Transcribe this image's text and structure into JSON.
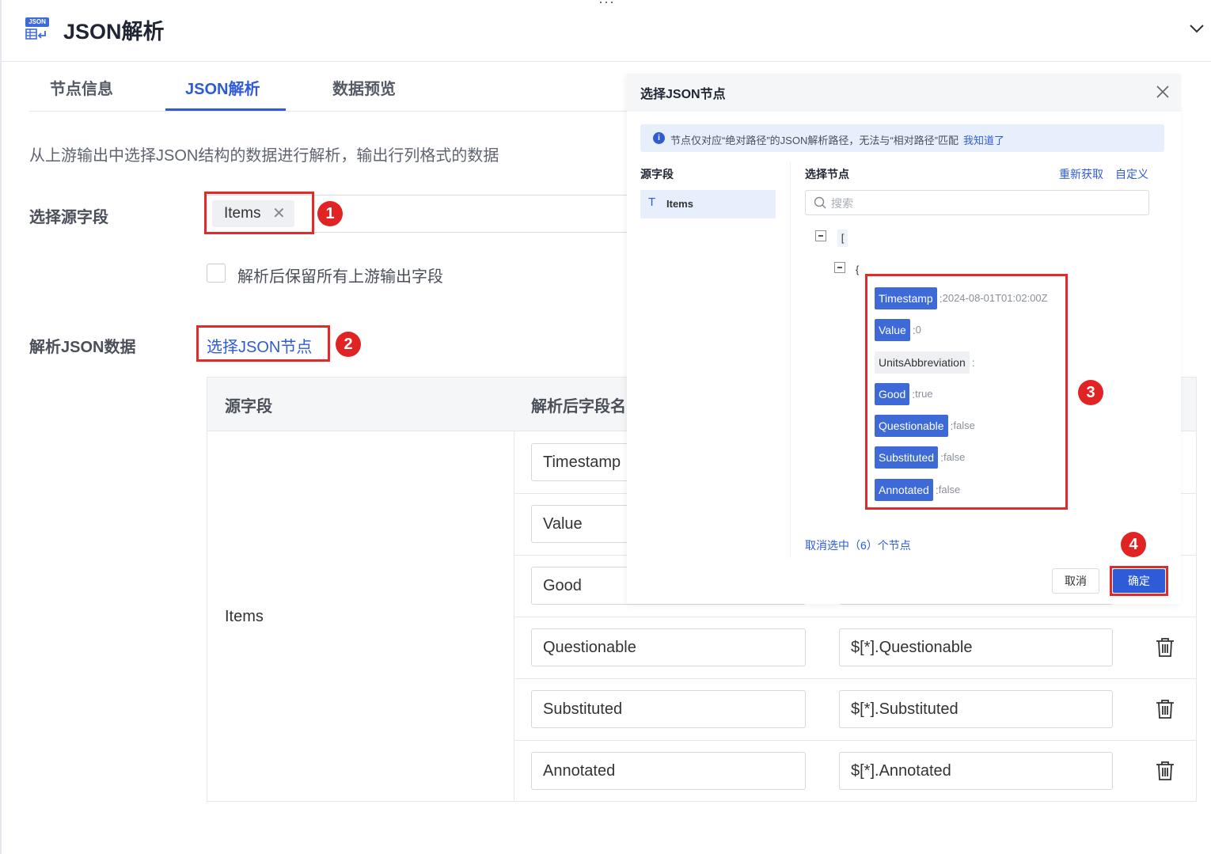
{
  "header": {
    "icon_tag": "JSON",
    "title": "JSON解析"
  },
  "tabs": [
    {
      "label": "节点信息",
      "active": false
    },
    {
      "label": "JSON解析",
      "active": true
    },
    {
      "label": "数据预览",
      "active": false
    }
  ],
  "description": "从上游输出中选择JSON结构的数据进行解析，输出行列格式的数据",
  "form": {
    "source_label": "选择源字段",
    "source_chip": "Items",
    "keep_fields_label": "解析后保留所有上游输出字段",
    "keep_fields_checked": false,
    "parse_label": "解析JSON数据",
    "select_node_link": "选择JSON节点"
  },
  "badges": [
    "1",
    "2",
    "3",
    "4"
  ],
  "table": {
    "headers": [
      "源字段",
      "解析后字段名"
    ],
    "source_value": "Items",
    "rows": [
      {
        "name": "Timestamp",
        "path": ""
      },
      {
        "name": "Value",
        "path": ""
      },
      {
        "name": "Good",
        "path": ""
      },
      {
        "name": "Questionable",
        "path": "$[*].Questionable"
      },
      {
        "name": "Substituted",
        "path": "$[*].Substituted"
      },
      {
        "name": "Annotated",
        "path": "$[*].Annotated"
      }
    ]
  },
  "modal": {
    "title": "选择JSON节点",
    "info": "节点仅对应“绝对路径”的JSON解析路径，无法与“相对路径”匹配",
    "info_link": "我知道了",
    "source_col_title": "源字段",
    "source_item": "Items",
    "source_item_icon": "T",
    "node_col_title": "选择节点",
    "refetch": "重新获取",
    "custom": "自定义",
    "search_placeholder": "搜索",
    "array_bracket": "[",
    "object_brace": "{",
    "nodes": [
      {
        "key": "Timestamp",
        "value": "2024-08-01T01:02:00Z",
        "selected": true
      },
      {
        "key": "Value",
        "value": "0",
        "selected": true
      },
      {
        "key": "UnitsAbbreviation",
        "value": "",
        "selected": false
      },
      {
        "key": "Good",
        "value": "true",
        "selected": true
      },
      {
        "key": "Questionable",
        "value": "false",
        "selected": true
      },
      {
        "key": "Substituted",
        "value": "false",
        "selected": true
      },
      {
        "key": "Annotated",
        "value": "false",
        "selected": true
      }
    ],
    "deselect": "取消选中（6）个节点",
    "cancel": "取消",
    "confirm": "确定"
  },
  "colors": {
    "accent": "#2e5bd8",
    "annotation_red": "#e02b2b",
    "selected_node": "#3d6ad6"
  }
}
